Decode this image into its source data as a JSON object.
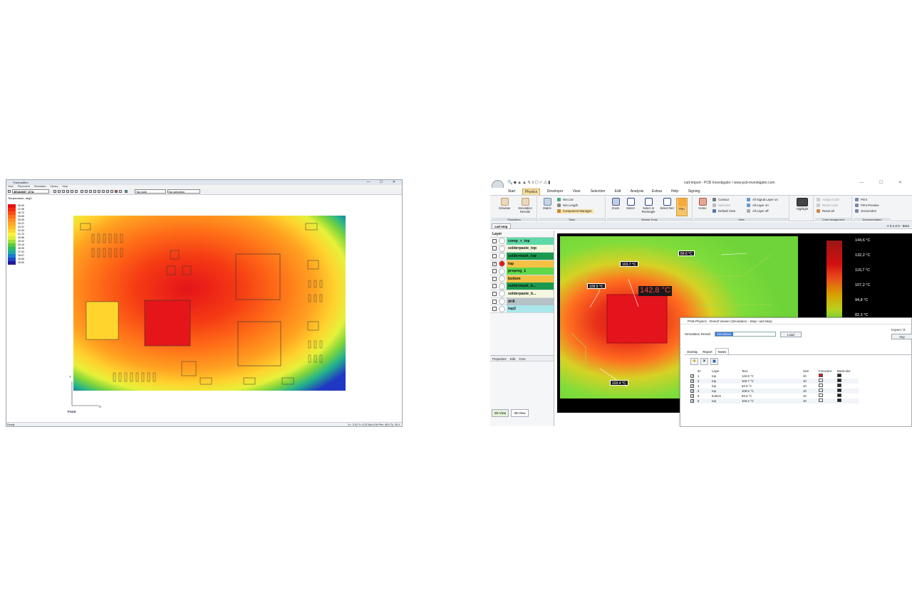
{
  "thermalsim": {
    "title": "ThermalSim",
    "window_controls": "— ☐ ✕",
    "menu": [
      "View",
      "Placement",
      "Simulation",
      "Library",
      "Help"
    ],
    "toolbar": {
      "design_select": "4E184657_D7A",
      "side_select": "Top side",
      "selection_select": "No selection"
    },
    "legend": {
      "title": "Temperature, degC",
      "values": [
        "39.40",
        "37.96",
        "36.72",
        "35.89",
        "35.05",
        "34.21",
        "33.37",
        "32.54",
        "31.70",
        "30.86",
        "30.02",
        "29.19",
        "28.35",
        "27.51",
        "26.67",
        "25.84",
        "25.00"
      ],
      "colors": [
        "#e31010",
        "#f22d12",
        "#ff4d12",
        "#ff7019",
        "#ff8f1f",
        "#ffa722",
        "#ffbf26",
        "#ffd82e",
        "#fff23a",
        "#d8f03b",
        "#9fe03a",
        "#5ec93a",
        "#2fba6b",
        "#21a8a2",
        "#1a7bd0",
        "#2145c8",
        "#241a9a"
      ]
    },
    "axis": {
      "y": "Y",
      "x": "X",
      "view_label": "Front"
    },
    "status": {
      "left": "Ready",
      "coords": "X= -3.41 Y= 4.32 Ws=0.94 Pts= 46.0 Tj= 39.4"
    }
  },
  "pcb": {
    "window_title": "cad-import - PCB Investigator / www.pcb-investigator.com",
    "window_controls": "— ☐ ✕",
    "tabs": [
      "Start",
      "Physics",
      "Developer",
      "View",
      "Selection",
      "Edit",
      "Analysis",
      "Extras",
      "Help",
      "Signing"
    ],
    "active_tab": "Physics",
    "ribbon": {
      "simulation": {
        "label": "Simulation",
        "simulate": "Simulate",
        "results": "Simulation Results"
      },
      "tools": {
        "label": "Tools",
        "matrix": "Matrix",
        "net_list": "Net List",
        "net_length": "Net Length",
        "component_manager": "Component Manager"
      },
      "mouse_tools": {
        "label": "Mouse Tools",
        "zoom": "Zoom",
        "select": "Select",
        "select_rect": "Select in Rectangle",
        "select_net": "Select Net",
        "pan": "Pan"
      },
      "view": {
        "label": "View",
        "home": "Home",
        "contour": "Contour",
        "selection": "Selection",
        "default_view": "Default View",
        "all_signal_on": "All Signal Layer on",
        "all_layer_on": "All Layer on",
        "all_layer_off": "All Layer off"
      },
      "highlight": {
        "label": "Highlight"
      },
      "color": {
        "label": "Color Assignment",
        "assign": "Assign Color",
        "reset": "Reset Color",
        "reset_all": "Reset all"
      },
      "doc": {
        "label": "Documentation",
        "print": "Print",
        "preview": "Print Preview",
        "screenshot": "Screenshot"
      }
    },
    "doc_tab": "cad-step",
    "version": "V 8.1.0.0 - Beta",
    "layer_header": "Layer",
    "layers": [
      {
        "name": "comp_+_top",
        "color": "#5fd9a7",
        "dot": "#ffffff",
        "checked": false
      },
      {
        "name": "solderpaste_top",
        "color": "#f6f7df",
        "dot": "#ffffff",
        "checked": false
      },
      {
        "name": "soldermask_top",
        "color": "#1b9a4f",
        "dot": "#ffffff",
        "checked": false
      },
      {
        "name": "top",
        "color": "#f3c244",
        "dot": "#e01818",
        "checked": true
      },
      {
        "name": "prepreg_1",
        "color": "#5fd94a",
        "dot": "#ffffff",
        "checked": false
      },
      {
        "name": "bottom",
        "color": "#f3c244",
        "dot": "#ffffff",
        "checked": false
      },
      {
        "name": "soldermask_b...",
        "color": "#1b9a4f",
        "dot": "#ffffff",
        "checked": false
      },
      {
        "name": "solderpaste_b...",
        "color": "#f6f7df",
        "dot": "#ffffff",
        "checked": false
      },
      {
        "name": "drill",
        "color": "#b7c1c8",
        "dot": "#ffffff",
        "checked": false
      },
      {
        "name": "top2",
        "color": "#a9e7ec",
        "dot": "#ffffff",
        "checked": false
      }
    ],
    "prop_tabs": [
      "Properties",
      "Edit",
      "Cmo"
    ],
    "view_tabs": [
      "2D-View",
      "3D-View"
    ],
    "colorbar_labels": [
      "144,6 °C",
      "132,2 °C",
      "119,7 °C",
      "107,2 °C",
      "94,8 °C",
      "82,3 °C"
    ],
    "callouts": [
      "103.7 °C",
      "84.6 °C",
      "109.5 °C",
      "142.8 °C",
      "103.4 °C"
    ],
    "result_viewer": {
      "title": "PCB-Physics - Result Viewer (Simulation - Step: cad-step)",
      "sim_result_label": "Simulation Result:",
      "sim_result_value": "Simulation",
      "load": "Load",
      "import_label": "Import / E",
      "import_btn": "Imp",
      "tabs": [
        "Overlay",
        "Report",
        "Notes"
      ],
      "active_tab": "Notes",
      "columns": [
        "",
        "ID",
        "Layer",
        "Text",
        "Size",
        "Forecolor",
        "Backcolor"
      ],
      "rows": [
        {
          "id": "1",
          "layer": "top",
          "text": "142.8 °C",
          "size": "20",
          "fore": "#e01818"
        },
        {
          "id": "2",
          "layer": "top",
          "text": "103.7 °C",
          "size": "10",
          "fore": "#ffffff"
        },
        {
          "id": "3",
          "layer": "top",
          "text": "84.6 °C",
          "size": "10",
          "fore": "#ffffff"
        },
        {
          "id": "4",
          "layer": "top",
          "text": "109.5 °C",
          "size": "10",
          "fore": "#ffffff"
        },
        {
          "id": "5",
          "layer": "bottom",
          "text": "83.6 °C",
          "size": "10",
          "fore": "#ffffff"
        },
        {
          "id": "6",
          "layer": "top",
          "text": "103.4 °C",
          "size": "10",
          "fore": "#ffffff"
        }
      ]
    }
  }
}
